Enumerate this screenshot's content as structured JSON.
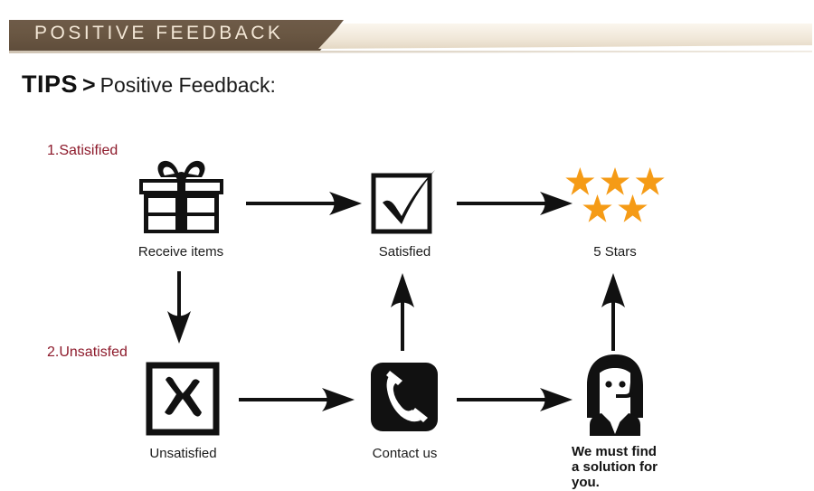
{
  "banner": {
    "title": "POSITIVE  FEEDBACK",
    "brown_color": "#6a5743",
    "cream_color": "#f3ecdf",
    "text_color": "#f3e7d6"
  },
  "tips": {
    "label": "TIPS",
    "separator": ">",
    "subject": "Positive Feedback:"
  },
  "flow": {
    "branches": [
      {
        "name": "satisfied-branch",
        "label": "1.Satisified",
        "color": "#8d1a2b"
      },
      {
        "name": "unsatisfied-branch",
        "label": "2.Unsatisfed",
        "color": "#8d1a2b"
      }
    ],
    "nodes": [
      {
        "id": "receive-items",
        "icon": "gift-box-icon",
        "label": "Receive items"
      },
      {
        "id": "satisfied",
        "icon": "checkmark-box-icon",
        "label": "Satisfied"
      },
      {
        "id": "five-stars",
        "icon": "five-stars-icon",
        "label": "5 Stars",
        "star_count": 5,
        "star_color": "#f59b16"
      },
      {
        "id": "unsatisfied",
        "icon": "x-box-icon",
        "label": "Unsatisfied"
      },
      {
        "id": "contact-us",
        "icon": "phone-handset-icon",
        "label": "Contact us"
      },
      {
        "id": "support-agent",
        "icon": "support-agent-icon",
        "label": "We must find a solution for you."
      }
    ],
    "caption_lines": [
      "We must find",
      "a solution for",
      "you."
    ]
  }
}
